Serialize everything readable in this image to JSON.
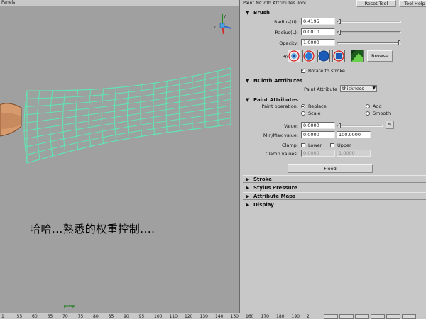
{
  "viewport": {
    "title": "Panels",
    "caption": "哈哈...熟悉的权重控制....",
    "camera": "persp"
  },
  "timeline": {
    "ticks": [
      "1",
      "55",
      "60",
      "65",
      "70",
      "75",
      "80",
      "85",
      "90",
      "95",
      "100",
      "110",
      "120",
      "130",
      "140",
      "150",
      "160",
      "170",
      "180",
      "190",
      "2"
    ]
  },
  "tool": {
    "title": "Paint NCloth Attributes Tool",
    "reset_label": "Reset Tool",
    "help_label": "Tool Help"
  },
  "brush": {
    "header": "Brush",
    "radius_u_label": "Radius(U):",
    "radius_u": "0.4195",
    "radius_l_label": "Radius(L):",
    "radius_l": "0.0010",
    "opacity_label": "Opacity:",
    "opacity": "1.0000",
    "profile_label": "Profile:",
    "browse_label": "Browse",
    "rotate_label": "Rotate to stroke"
  },
  "ncloth": {
    "header": "NCloth Attributes",
    "paint_attribute_label": "Paint Attribute",
    "paint_attribute_value": "thickness"
  },
  "paint": {
    "header": "Paint Attributes",
    "operation_label": "Paint operation:",
    "op_replace": "Replace",
    "op_add": "Add",
    "op_scale": "Scale",
    "op_smooth": "Smooth",
    "value_label": "Value:",
    "value": "0.0000",
    "minmax_label": "Min/Max value:",
    "min": "0.0000",
    "max": "100.0000",
    "clamp_label": "Clamp:",
    "clamp_lower": "Lower",
    "clamp_upper": "Upper",
    "clamp_values_label": "Clamp values:",
    "clamp_min": "0.0000",
    "clamp_max": "1.0000",
    "flood_label": "Flood"
  },
  "collapsed_sections": [
    "Stroke",
    "Stylus Pressure",
    "Attribute Maps",
    "Display"
  ],
  "colors": {
    "viewport_bg": "#a0a0a0",
    "mesh": "#5fe7b4",
    "panel_bg": "#c8c8c8",
    "skin": "#d79a6c"
  }
}
